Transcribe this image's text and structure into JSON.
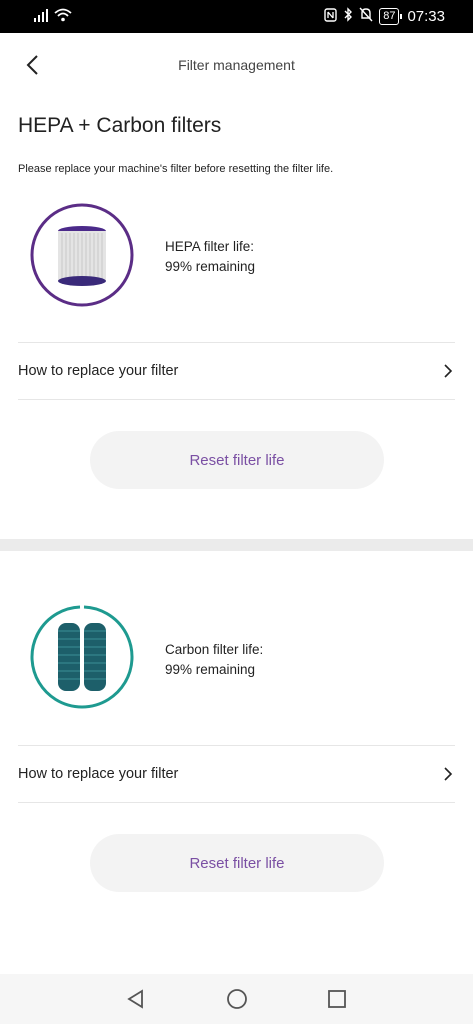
{
  "status_bar": {
    "battery": "87",
    "time": "07:33",
    "icons": [
      "signal-icon",
      "wifi-icon",
      "nfc-icon",
      "bluetooth-icon",
      "mute-icon",
      "battery-icon"
    ]
  },
  "header": {
    "title": "Filter management",
    "back_icon": "chevron-left-icon"
  },
  "section": {
    "title": "HEPA + Carbon filters",
    "instruction": "Please replace your machine's filter before resetting the filter life."
  },
  "filters": [
    {
      "life_label": "HEPA filter life:",
      "remaining": "99% remaining",
      "remaining_fraction": 0.99,
      "ring_color": "#5b2d86",
      "replace_label": "How to replace your filter",
      "reset_label": "Reset filter life"
    },
    {
      "life_label": "Carbon filter life:",
      "remaining": "99% remaining",
      "remaining_fraction": 0.99,
      "ring_color": "#1e9a90",
      "replace_label": "How to replace your filter",
      "reset_label": "Reset filter life"
    }
  ],
  "colors": {
    "accent": "#7a4fa3",
    "button_bg": "#f3f3f3",
    "divider": "#ebebeb"
  },
  "nav_bar": {
    "icons": [
      "back-triangle-icon",
      "home-circle-icon",
      "recents-square-icon"
    ]
  }
}
